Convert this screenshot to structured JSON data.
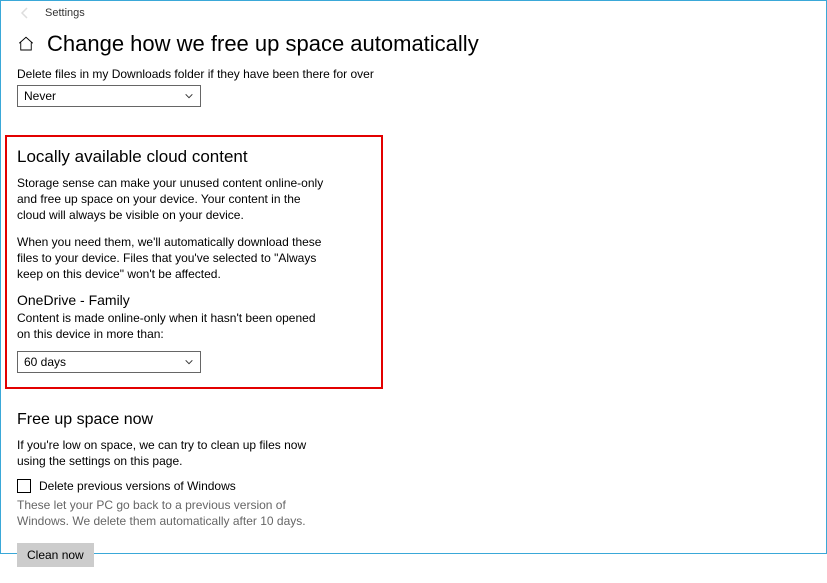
{
  "window": {
    "app_title": "Settings"
  },
  "header": {
    "page_title": "Change how we free up space automatically"
  },
  "downloads": {
    "label": "Delete files in my Downloads folder if they have been there for over",
    "value": "Never"
  },
  "cloud": {
    "section_title": "Locally available cloud content",
    "para1": "Storage sense can make your unused content online-only and free up space on your device. Your content in the cloud will always be visible on your device.",
    "para2": "When you need them, we'll automatically download these files to your device. Files that you've selected to \"Always keep on this device\" won't be affected.",
    "account_title": "OneDrive - Family",
    "account_desc": "Content is made online-only when it hasn't been opened on this device in more than:",
    "value": "60 days"
  },
  "freeup": {
    "section_title": "Free up space now",
    "desc": "If you're low on space, we can try to clean up files now using the settings on this page.",
    "checkbox_label": "Delete previous versions of Windows",
    "checkbox_note": "These let your PC go back to a previous version of Windows. We delete them automatically after 10 days.",
    "button": "Clean now"
  }
}
